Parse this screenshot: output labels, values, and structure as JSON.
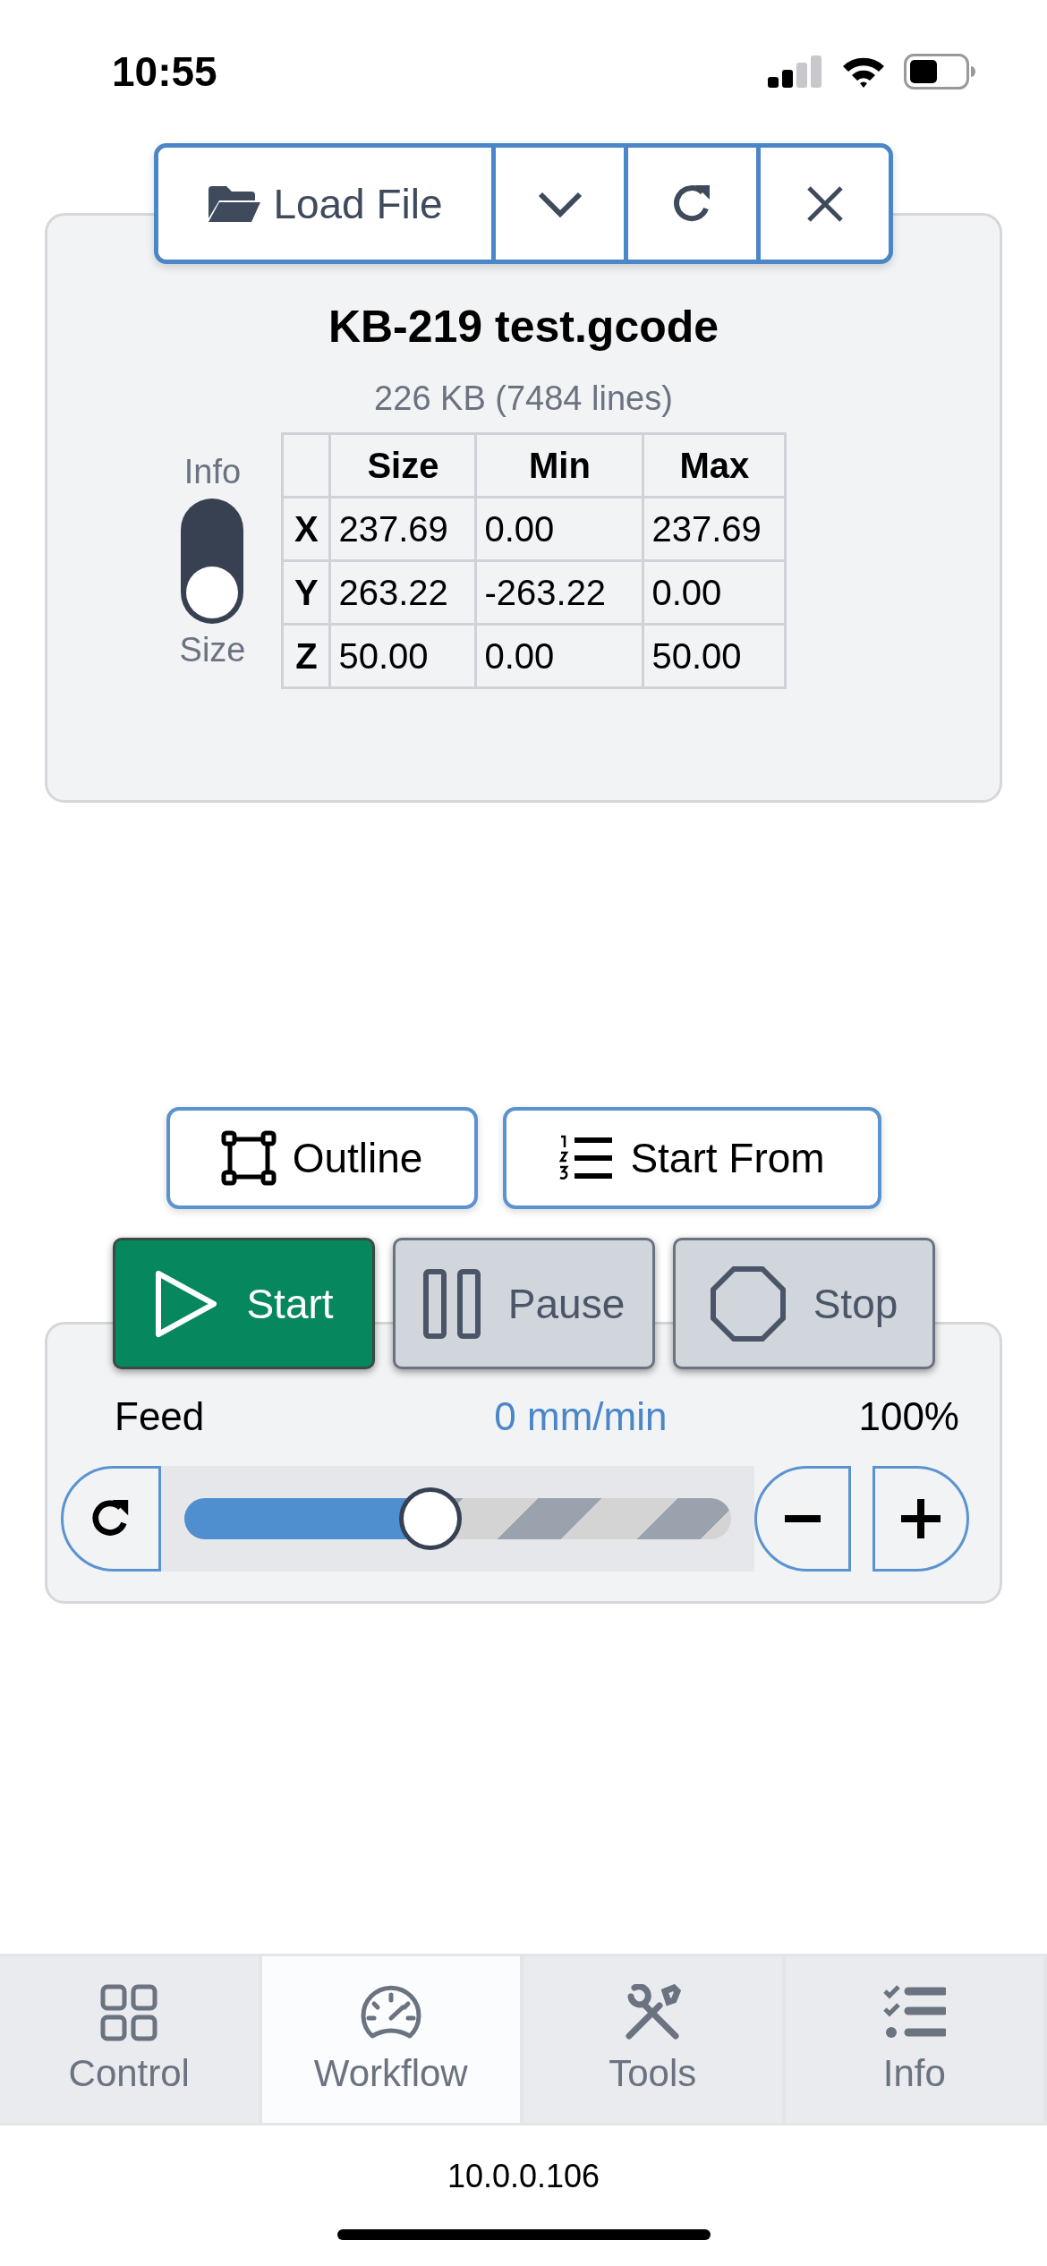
{
  "status_bar": {
    "time": "10:55"
  },
  "file_toolbar": {
    "load_label": "Load File"
  },
  "file_info": {
    "name": "KB-219 test.gcode",
    "details": "226 KB (7484 lines)",
    "toggle": {
      "top_label": "Info",
      "bottom_label": "Size",
      "on": true
    },
    "table": {
      "columns": [
        "",
        "Size",
        "Min",
        "Max"
      ],
      "rows": [
        [
          "X",
          "237.69",
          "0.00",
          "237.69"
        ],
        [
          "Y",
          "263.22",
          "-263.22",
          "0.00"
        ],
        [
          "Z",
          "50.00",
          "0.00",
          "50.00"
        ]
      ]
    }
  },
  "actions": [
    {
      "kind": "outline",
      "label": "Outline"
    },
    {
      "kind": "start_from",
      "label": "Start From"
    }
  ],
  "run_buttons": [
    {
      "kind": "start",
      "label": "Start",
      "disabled": false
    },
    {
      "kind": "pause",
      "label": "Pause",
      "disabled": true
    },
    {
      "kind": "stop",
      "label": "Stop",
      "disabled": true
    }
  ],
  "feed": {
    "label": "Feed",
    "rate": "0 mm/min",
    "percent": "100%",
    "level": 0.45
  },
  "tabs": [
    {
      "kind": "control",
      "label": "Control",
      "selected": false
    },
    {
      "kind": "workflow",
      "label": "Workflow",
      "selected": true
    },
    {
      "kind": "tools",
      "label": "Tools",
      "selected": false
    },
    {
      "kind": "info",
      "label": "Info",
      "selected": false
    }
  ],
  "footer": {
    "address": "10.0.0.106"
  }
}
